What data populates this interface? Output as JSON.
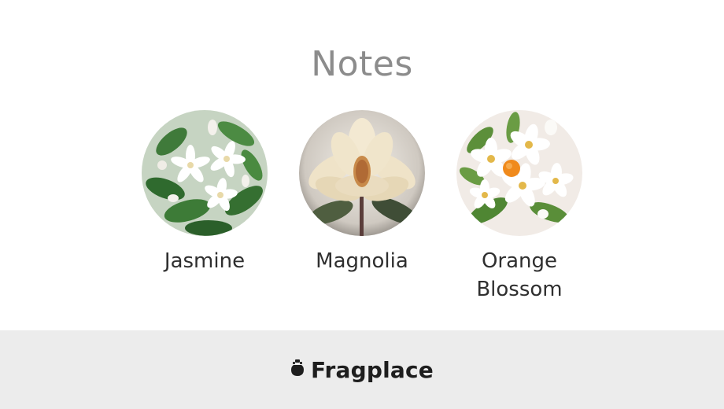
{
  "header": {
    "title": "Notes"
  },
  "notes": [
    {
      "label": "Jasmine",
      "icon": "jasmine-flower-image"
    },
    {
      "label": "Magnolia",
      "icon": "magnolia-flower-image"
    },
    {
      "label": "Orange\nBlossom",
      "icon": "orange-blossom-flower-image"
    }
  ],
  "footer": {
    "brand": "Fragplace",
    "logo_icon": "perfume-bottle-icon"
  },
  "colors": {
    "title": "#8c8c8c",
    "label": "#2f2f2f",
    "footer_bg": "#ececec",
    "brand": "#1e1e1e"
  }
}
